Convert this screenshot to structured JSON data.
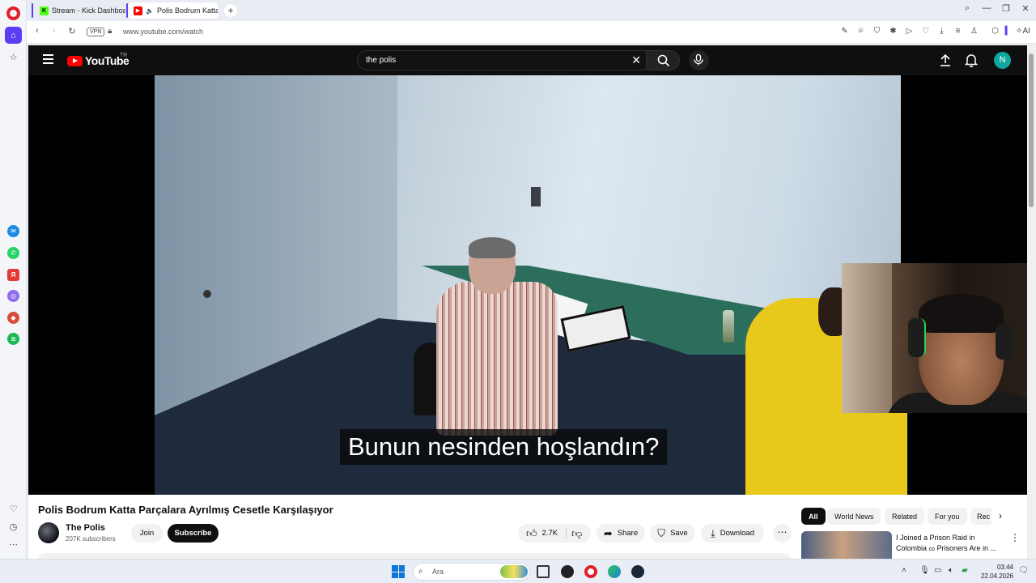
{
  "browser": {
    "tabs": [
      {
        "title": "Stream - Kick Dashboard",
        "active": false
      },
      {
        "title": "Polis Bodrum Katta Pa",
        "active": true
      }
    ],
    "new_tab": "+",
    "vpn_label": "VPN",
    "url": "www.youtube.com/watch",
    "ai_label": "AI"
  },
  "youtube": {
    "logo_text": "YouTube",
    "region": "TR",
    "search_value": "the polis",
    "avatar_letter": "N",
    "subtitle": "Bunun nesinden hoşlandın?",
    "video": {
      "title": "Polis Bodrum Katta Parçalara Ayrılmış Cesetle Karşılaşıyor",
      "channel": "The Polis",
      "subscribers": "207K subscribers",
      "join_label": "Join",
      "subscribe_label": "Subscribe",
      "likes": "2.7K",
      "share_label": "Share",
      "save_label": "Save",
      "download_label": "Download"
    },
    "chips": [
      "All",
      "World News",
      "Related",
      "For you",
      "Rec"
    ],
    "recommendation": {
      "title_line1": "I Joined a Prison Raid in",
      "title_line2": "Colombia",
      "title_line2_tail": "Prisoners Are in ..."
    }
  },
  "taskbar": {
    "search_placeholder": "Ara",
    "time": "03:44",
    "date": "22.04.2026"
  },
  "colors": {
    "opera_red": "#e11d2a",
    "opera_accent": "#5b3df5",
    "youtube_red": "#ff0000",
    "youtube_dark": "#0f0f0f",
    "avatar_teal": "#10a7a0"
  }
}
